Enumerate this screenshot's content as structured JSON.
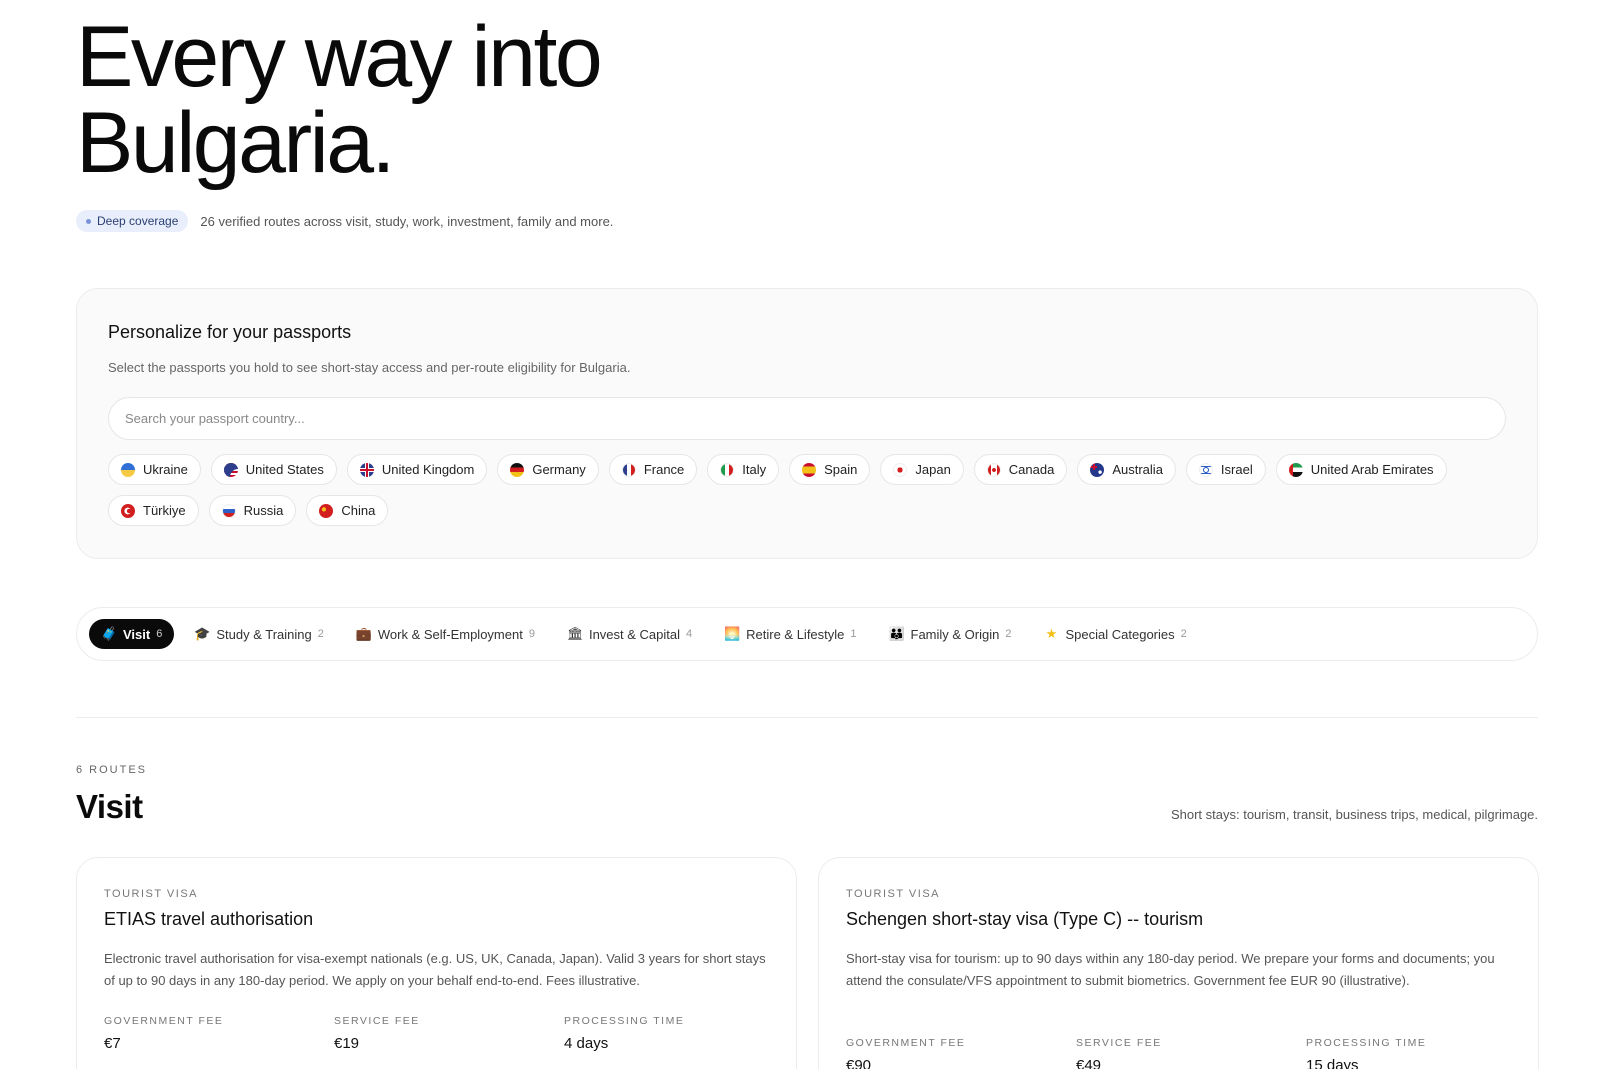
{
  "hero": {
    "title_line1": "Every way into",
    "title_line2": "Bulgaria.",
    "badge": "Deep coverage",
    "summary": "26 verified routes across visit, study, work, investment, family and more."
  },
  "passports": {
    "title": "Personalize for your passports",
    "subtitle": "Select the passports you hold to see short-stay access and per-route eligibility for Bulgaria.",
    "search_placeholder": "Search your passport country...",
    "countries": [
      {
        "name": "Ukraine",
        "flag": "ua-flag"
      },
      {
        "name": "United States",
        "flag": "us-flag"
      },
      {
        "name": "United Kingdom",
        "flag": "uk-flag"
      },
      {
        "name": "Germany",
        "flag": "de-flag"
      },
      {
        "name": "France",
        "flag": "fr-flag"
      },
      {
        "name": "Italy",
        "flag": "it-flag"
      },
      {
        "name": "Spain",
        "flag": "es-flag"
      },
      {
        "name": "Japan",
        "flag": "jp-flag"
      },
      {
        "name": "Canada",
        "flag": "ca-flag"
      },
      {
        "name": "Australia",
        "flag": "au-flag"
      },
      {
        "name": "Israel",
        "flag": "il-flag"
      },
      {
        "name": "United Arab Emirates",
        "flag": "ae-flag"
      },
      {
        "name": "Türkiye",
        "flag": "tr-flag"
      },
      {
        "name": "Russia",
        "flag": "ru-flag"
      },
      {
        "name": "China",
        "flag": "cn-flag"
      }
    ]
  },
  "tabs": [
    {
      "label": "Visit",
      "count": "6",
      "icon": "luggage-icon",
      "active": true
    },
    {
      "label": "Study & Training",
      "count": "2",
      "icon": "graduation-cap-icon",
      "active": false
    },
    {
      "label": "Work & Self-Employment",
      "count": "9",
      "icon": "briefcase-icon",
      "active": false
    },
    {
      "label": "Invest & Capital",
      "count": "4",
      "icon": "bank-icon",
      "active": false
    },
    {
      "label": "Retire & Lifestyle",
      "count": "1",
      "icon": "sunset-icon",
      "active": false
    },
    {
      "label": "Family & Origin",
      "count": "2",
      "icon": "family-icon",
      "active": false
    },
    {
      "label": "Special Categories",
      "count": "2",
      "icon": "star-icon",
      "active": false
    }
  ],
  "section": {
    "count_label": "6 ROUTES",
    "title": "Visit",
    "description": "Short stays: tourism, transit, business trips, medical, pilgrimage."
  },
  "cards": [
    {
      "type": "TOURIST VISA",
      "title": "ETIAS travel authorisation",
      "description": "Electronic travel authorisation for visa-exempt nationals (e.g. US, UK, Canada, Japan). Valid 3 years for short stays of up to 90 days in any 180-day period. We apply on your behalf end-to-end. Fees illustrative.",
      "gov_fee_label": "GOVERNMENT FEE",
      "gov_fee": "€7",
      "service_fee_label": "SERVICE FEE",
      "service_fee": "€19",
      "processing_label": "PROCESSING TIME",
      "processing": "4 days"
    },
    {
      "type": "TOURIST VISA",
      "title": "Schengen short-stay visa (Type C) -- tourism",
      "description": "Short-stay visa for tourism: up to 90 days within any 180-day period. We prepare your forms and documents; you attend the consulate/VFS appointment to submit biometrics. Government fee EUR 90 (illustrative).",
      "gov_fee_label": "GOVERNMENT FEE",
      "gov_fee": "€90",
      "service_fee_label": "SERVICE FEE",
      "service_fee": "€49",
      "processing_label": "PROCESSING TIME",
      "processing": "15 days"
    }
  ]
}
